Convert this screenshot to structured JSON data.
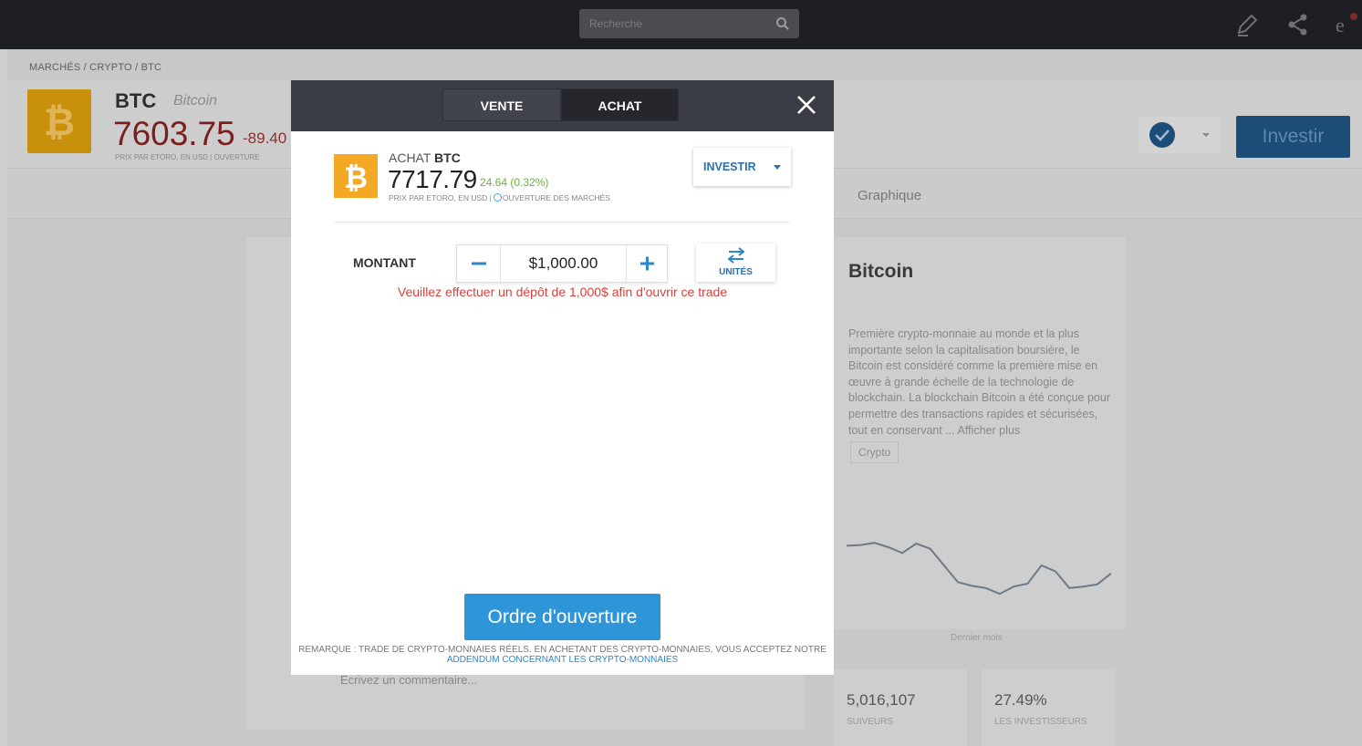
{
  "topbar": {
    "search_placeholder": "Recherche",
    "icons": [
      "search-icon",
      "pencil-icon",
      "share-icon",
      "etoro-logo-icon"
    ]
  },
  "breadcrumb": "MARCHÉS / CRYPTO / BTC",
  "asset_header": {
    "symbol": "BTC",
    "name": "Bitcoin",
    "price": "7603.75",
    "change": "-89.40",
    "subline": "PRIX PAR ETORO, EN USD | OUVERTURE",
    "invest_button": "Investir"
  },
  "tabs": {
    "graph_label": "Graphique"
  },
  "about_card": {
    "title": "Bitcoin",
    "description": "Première crypto-monnaie au monde et la plus importante selon la capitalisation boursière, le Bitcoin est considéré comme la première mise en œuvre à grande échelle de la technologie de blockchain. La blockchain Bitcoin a été conçue pour permettre des transactions rapides et sécurisées, tout en conservant ... Afficher plus",
    "tag": "Crypto",
    "sparkline_caption": "Dernier mois",
    "sparkline_values": [
      0.82,
      0.83,
      0.86,
      0.8,
      0.72,
      0.85,
      0.78,
      0.55,
      0.32,
      0.27,
      0.24,
      0.16,
      0.26,
      0.3,
      0.55,
      0.47,
      0.24,
      0.26,
      0.29,
      0.44
    ]
  },
  "stats": [
    {
      "value": "5,016,107",
      "label": "SUIVEURS"
    },
    {
      "value": "27.49%",
      "label": "LES INVESTISSEURS"
    }
  ],
  "comment_placeholder": "Écrivez un commentaire...",
  "modal": {
    "tab_sell": "VENTE",
    "tab_buy": "ACHAT",
    "action": "ACHAT",
    "symbol": "BTC",
    "price": "7717.79",
    "change": "24.64 (0.32%)",
    "price_source": "PRIX PAR ETORO, EN USD |",
    "market_status": "OUVERTURE DES MARCHÉS",
    "invest_dropdown": "INVESTIR",
    "amount_label": "MONTANT",
    "amount_value": "$1,000.00",
    "units_label": "UNITÉS",
    "warning": "Veuillez effectuer un dépôt de 1,000$ afin d'ouvrir ce trade",
    "open_order_button": "Ordre d'ouverture",
    "note_text": "REMARQUE : TRADE DE CRYPTO-MONNAIES RÉELS. EN ACHETANT DES CRYPTO-MONNAIES, VOUS ACCEPTEZ NOTRE",
    "note_link": "ADDENDUM CONCERNANT LES CRYPTO-MONNAIES"
  },
  "colors": {
    "accent_blue": "#2e95d9",
    "bitcoin_orange": "#f3a923",
    "positive_green": "#6ab03d",
    "warning_red": "#d9403a",
    "header_dark": "#3a3d45"
  }
}
